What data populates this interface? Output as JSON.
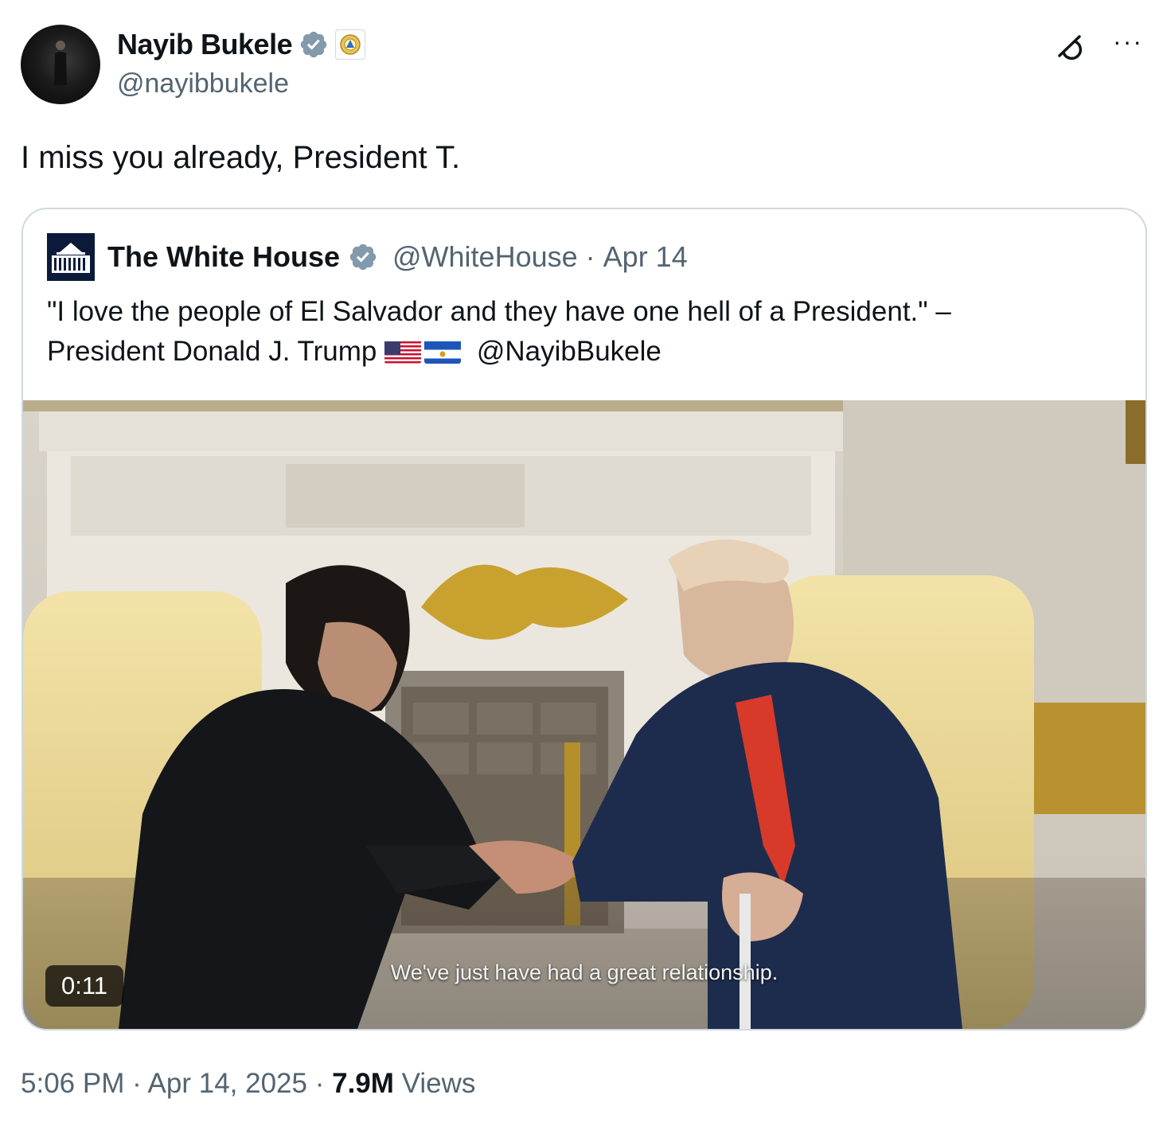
{
  "author": {
    "name": "Nayib Bukele",
    "handle": "@nayibbukele"
  },
  "tweet": {
    "text": "I miss you already, President T."
  },
  "quoted": {
    "name": "The White House",
    "handle": "@WhiteHouse",
    "separator": "·",
    "date": "Apr 14",
    "text_line1": "\"I love the people of El Salvador and they have one hell of a President.\" –",
    "text_line2_prefix": "President Donald J. Trump",
    "text_mention": "@NayibBukele",
    "video": {
      "duration": "0:11",
      "caption": "We've just have had a great relationship."
    }
  },
  "meta": {
    "time": "5:06 PM",
    "separator": "·",
    "date": "Apr 14, 2025",
    "views_count": "7.9M",
    "views_label": "Views"
  },
  "icons": {
    "verified": "verified-badge-icon",
    "affiliation": "government-seal-icon",
    "grok": "grok-icon",
    "more": "more-icon"
  },
  "colors": {
    "verified_badge": "#829aab",
    "secondary_text": "#536471",
    "border": "#cfd9de"
  }
}
